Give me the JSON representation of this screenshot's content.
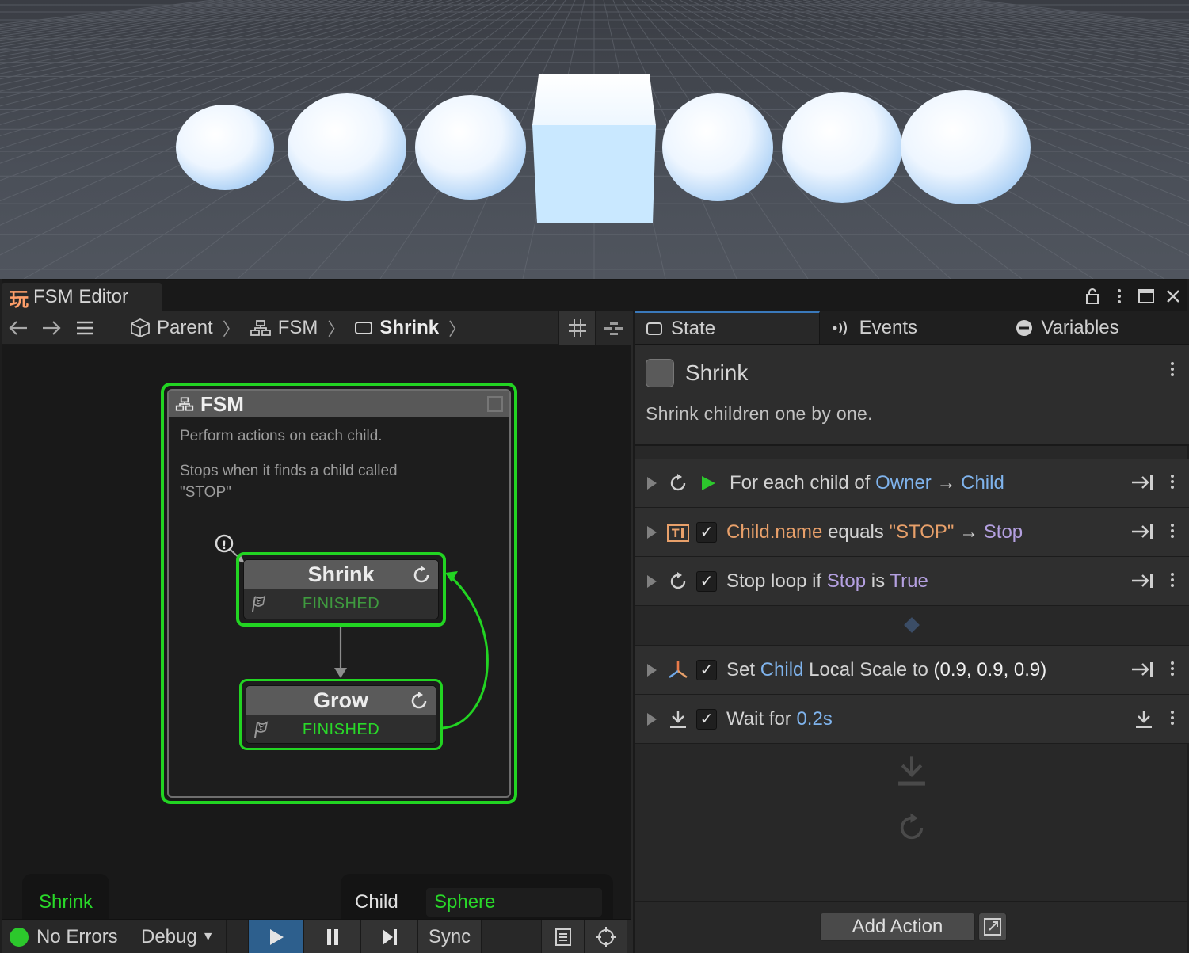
{
  "window": {
    "tab_title": "FSM Editor",
    "tab_icon_glyph": "玩",
    "controls": [
      "lock-icon",
      "kebab-icon",
      "maximize-icon",
      "close-icon"
    ]
  },
  "toolbar": {
    "breadcrumbs": [
      {
        "label": "Parent",
        "icon": "cube-icon"
      },
      {
        "label": "FSM",
        "icon": "hierarchy-icon"
      },
      {
        "label": "Shrink",
        "icon": "state-icon"
      }
    ]
  },
  "graph": {
    "group": {
      "title": "FSM",
      "desc1": "Perform actions on each child.",
      "desc2": "Stops when it finds a child called",
      "desc3": "\"STOP\""
    },
    "states": [
      {
        "name": "Shrink",
        "event": "FINISHED",
        "event_color": "#3f9a3f"
      },
      {
        "name": "Grow",
        "event": "FINISHED",
        "event_color": "#29d829"
      }
    ],
    "start_marker_glyph": "!",
    "active_state": "Shrink",
    "variable": {
      "name": "Child",
      "value": "Sphere"
    }
  },
  "statusbar": {
    "errors": "No Errors",
    "debug": "Debug",
    "sync": "Sync"
  },
  "inspector": {
    "tabs": [
      "State",
      "Events",
      "Variables"
    ],
    "state_name": "Shrink",
    "state_description": "Shrink children one by one.",
    "actions": [
      {
        "parts": [
          [
            "For each child of ",
            ""
          ],
          [
            "Owner",
            "c-blue"
          ],
          [
            " → ",
            ""
          ],
          [
            "Child",
            "c-blue"
          ]
        ]
      },
      {
        "parts": [
          [
            "Child.name",
            "c-orange"
          ],
          [
            " equals ",
            ""
          ],
          [
            "\"STOP\"",
            "c-orange"
          ],
          [
            " → ",
            ""
          ],
          [
            "Stop",
            "c-purple"
          ]
        ]
      },
      {
        "parts": [
          [
            "Stop loop if ",
            ""
          ],
          [
            "Stop",
            "c-purple"
          ],
          [
            " is ",
            ""
          ],
          [
            "True",
            "c-purple"
          ]
        ]
      },
      {
        "parts": [
          [
            "Set ",
            ""
          ],
          [
            "Child",
            "c-blue"
          ],
          [
            " Local Scale to ",
            ""
          ],
          [
            "(0.9, 0.9, 0.9)",
            "c-white"
          ]
        ]
      },
      {
        "parts": [
          [
            "Wait for ",
            ""
          ],
          [
            "0.2s",
            "c-blue"
          ]
        ]
      }
    ],
    "add_action_label": "Add Action"
  },
  "colors": {
    "active_green": "#22d422",
    "accent_blue": "#3a79bb",
    "play_blue": "#2d5f8d"
  }
}
